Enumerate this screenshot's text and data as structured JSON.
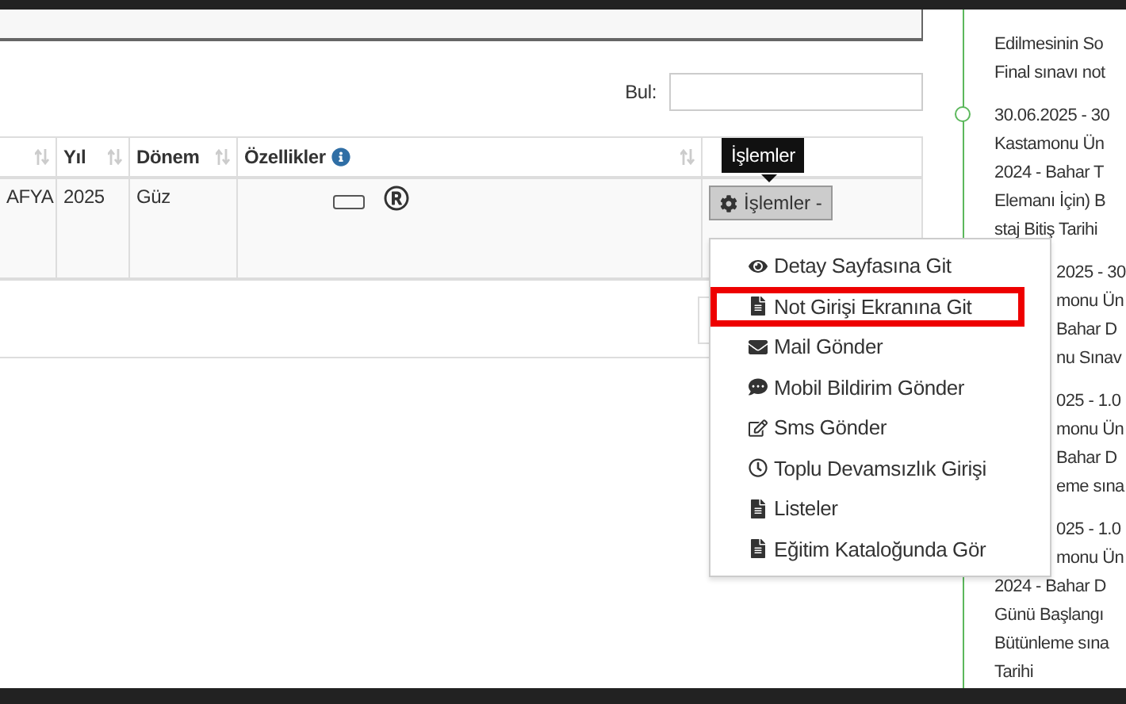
{
  "search": {
    "label": "Bul:"
  },
  "table": {
    "columns": [
      {
        "sortable": true
      },
      {
        "label": "Yıl",
        "sortable": true
      },
      {
        "label": "Dönem",
        "sortable": true
      },
      {
        "label": "Özellikler",
        "sortable": true,
        "info": true
      },
      {
        "sortable": false
      }
    ],
    "rows": [
      {
        "cells": [
          "AFYA",
          "2025",
          "Güz"
        ],
        "action_button": "İşlemler -"
      }
    ]
  },
  "tooltip": "İşlemler",
  "menu": {
    "items": [
      {
        "label": "Detay Sayfasına Git",
        "kind": "eye",
        "highlighted": false
      },
      {
        "label": "Not Girişi Ekranına Git",
        "kind": "file",
        "highlighted": true
      },
      {
        "label": "Mail Gönder",
        "kind": "envelope",
        "highlighted": false
      },
      {
        "label": "Mobil Bildirim Gönder",
        "kind": "comment",
        "highlighted": false
      },
      {
        "label": "Sms Gönder",
        "kind": "edit",
        "highlighted": false
      },
      {
        "label": "Toplu Devamsızlık Girişi",
        "kind": "clock",
        "highlighted": false
      },
      {
        "label": "Listeler",
        "kind": "file",
        "highlighted": false
      },
      {
        "label": "Eğitim Kataloğunda Gör",
        "kind": "file",
        "highlighted": false
      }
    ]
  },
  "timeline": [
    {
      "marker": false,
      "lines": [
        {
          "text": "Edilmesinin So",
          "clipped": false
        },
        {
          "text": "Final sınavı not",
          "clipped": false
        }
      ]
    },
    {
      "marker": true,
      "lines": [
        {
          "text": "30.06.2025 - 30",
          "clipped": false
        },
        {
          "text": "Kastamonu Ün",
          "clipped": false
        },
        {
          "text": "2024 - Bahar T",
          "clipped": false
        },
        {
          "text": "Elemanı İçin) B",
          "clipped": false
        },
        {
          "text": "staj Bitiş Tarihi",
          "clipped": false
        }
      ]
    },
    {
      "marker": false,
      "lines": [
        {
          "text": "2025 - 30",
          "clipped": true
        },
        {
          "text": "monu Ün",
          "clipped": true
        },
        {
          "text": "Bahar D",
          "clipped": true
        },
        {
          "text": "nu Sınav",
          "clipped": true
        }
      ]
    },
    {
      "marker": false,
      "lines": [
        {
          "text": "025 - 1.0",
          "clipped": true
        },
        {
          "text": "monu Ün",
          "clipped": true
        },
        {
          "text": "Bahar D",
          "clipped": true
        },
        {
          "text": "eme sına",
          "clipped": true
        }
      ]
    },
    {
      "marker": false,
      "lines": [
        {
          "text": "025 - 1.0",
          "clipped": true
        },
        {
          "text": "monu Ün",
          "clipped": true
        },
        {
          "text": "2024 - Bahar D",
          "clipped": false
        },
        {
          "text": "Günü Başlangı",
          "clipped": false
        },
        {
          "text": "Bütünleme sına",
          "clipped": false
        },
        {
          "text": "Tarihi",
          "clipped": false
        }
      ]
    }
  ]
}
